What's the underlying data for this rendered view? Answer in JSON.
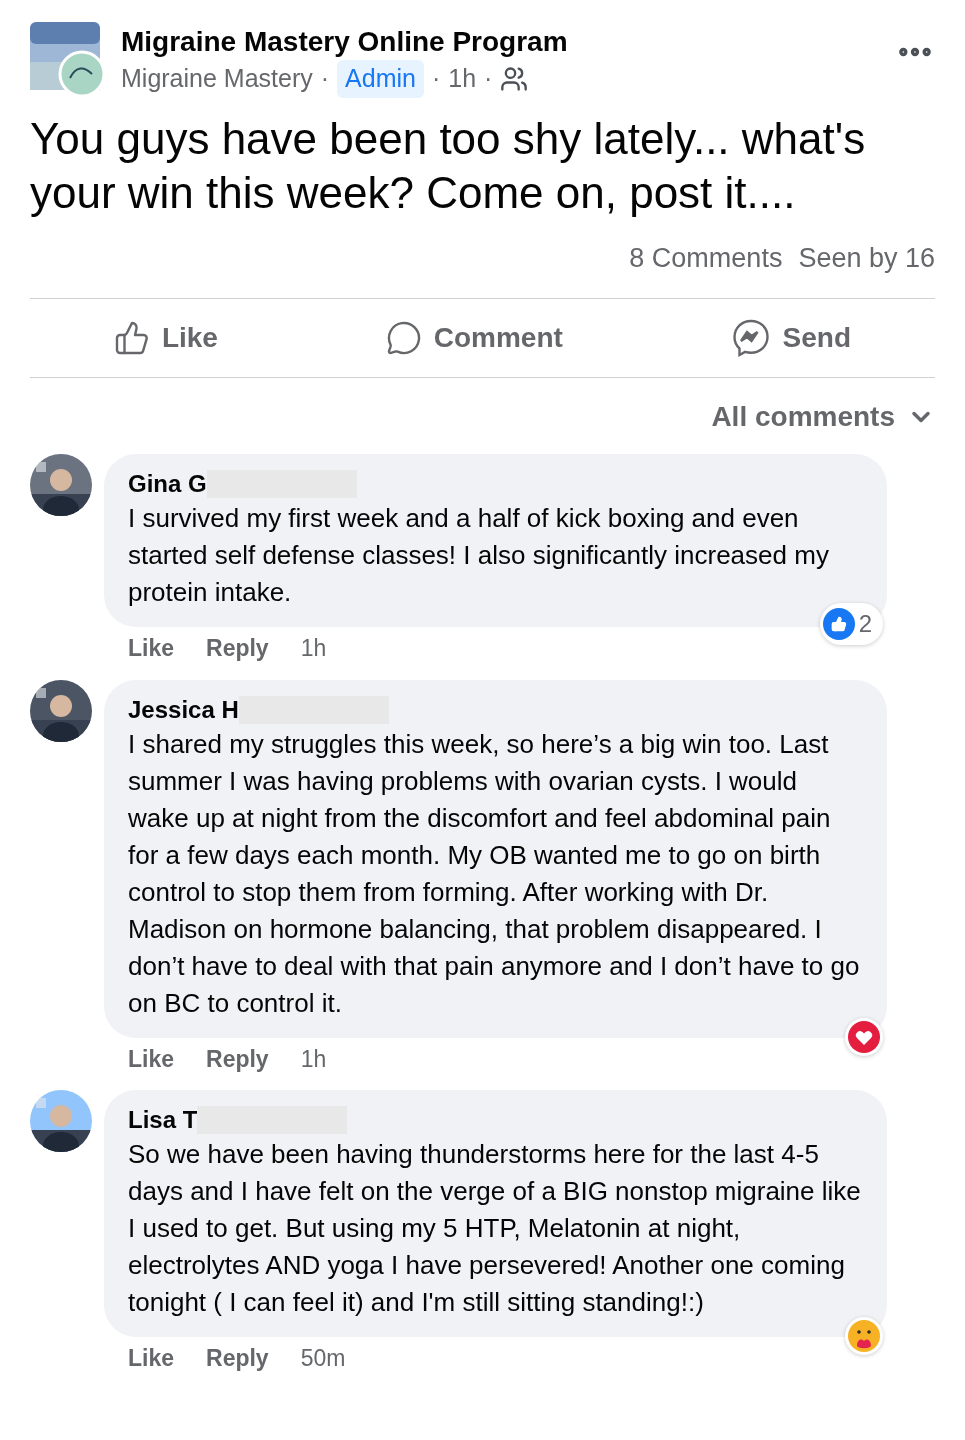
{
  "post": {
    "group": "Migraine Mastery Online Program",
    "author": "Migraine Mastery",
    "badge": "Admin",
    "time": "1h",
    "separators": [
      "·",
      "·",
      "·"
    ],
    "text": "You guys have been too shy lately... what's your win this week? Come on, post it...."
  },
  "stats": {
    "comments": "8 Comments",
    "seen": "Seen by 16"
  },
  "actions": [
    {
      "kind": "like",
      "label": "Like"
    },
    {
      "kind": "comment",
      "label": "Comment"
    },
    {
      "kind": "send",
      "label": "Send"
    }
  ],
  "sort": "All comments",
  "comments": [
    {
      "name": "Gina G",
      "redacted": true,
      "text": "I survived my first week and a half of kick boxing and even started self defense classes! I also significantly increased my protein intake.",
      "like": "Like",
      "reply": "Reply",
      "time": "1h",
      "reaction": {
        "kind": "like",
        "count": "2"
      }
    },
    {
      "name": "Jessica H",
      "redacted": true,
      "text": "I shared my struggles this week, so here’s a big win too. Last summer I was having problems with ovarian cysts. I would wake up at night from the discomfort and feel abdominal pain for a few days each month. My OB wanted me to go on birth control to stop them from forming. After working with Dr. Madison on hormone balancing, that problem disappeared. I don’t have to deal with that pain anymore and I don’t have to go on BC to control it.",
      "like": "Like",
      "reply": "Reply",
      "time": "1h",
      "reaction": {
        "kind": "love"
      }
    },
    {
      "name": "Lisa T",
      "redacted": true,
      "text": "So we have been having thunderstorms here for the last 4-5 days and I have felt on the verge of a BIG nonstop migraine like I used to get. But using my 5 HTP, Melatonin at night, electrolytes AND yoga I have persevered! Another one coming tonight ( I can feel it) and I'm still sitting standing!:)",
      "like": "Like",
      "reply": "Reply",
      "time": "50m",
      "reaction": {
        "kind": "care"
      }
    }
  ]
}
